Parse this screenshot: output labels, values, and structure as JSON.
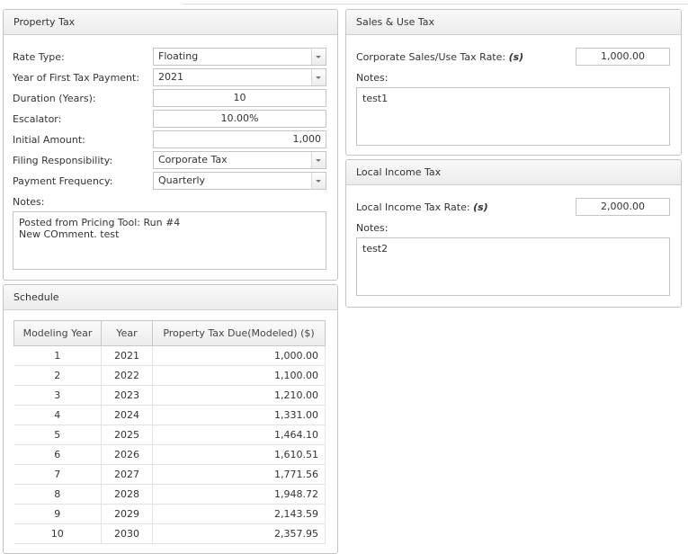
{
  "property_tax": {
    "title": "Property Tax",
    "rate_type": {
      "label": "Rate Type:",
      "value": "Floating"
    },
    "first_payment_year": {
      "label": "Year of First Tax Payment:",
      "value": "2021"
    },
    "duration": {
      "label": "Duration (Years):",
      "value": "10"
    },
    "escalator": {
      "label": "Escalator:",
      "value": "10.00%"
    },
    "initial_amount": {
      "label": "Initial Amount:",
      "value": "1,000"
    },
    "filing_responsibility": {
      "label": "Filing Responsibility:",
      "value": "Corporate Tax"
    },
    "payment_frequency": {
      "label": "Payment Frequency:",
      "value": "Quarterly"
    },
    "notes_label": "Notes:",
    "notes_lines": [
      "Posted from Pricing Tool: Run #4",
      "New COmment. test"
    ]
  },
  "sales_use_tax": {
    "title": "Sales & Use Tax",
    "rate_label": "Corporate Sales/Use Tax Rate:",
    "rate_unit": "(s)",
    "rate_value": "1,000.00",
    "notes_label": "Notes:",
    "notes": "test1"
  },
  "local_income_tax": {
    "title": "Local Income Tax",
    "rate_label": "Local Income Tax Rate:",
    "rate_unit": "(s)",
    "rate_value": "2,000.00",
    "notes_label": "Notes:",
    "notes": "test2"
  },
  "schedule": {
    "title": "Schedule",
    "columns": [
      "Modeling Year",
      "Year",
      "Property Tax Due(Modeled) ($)"
    ],
    "rows": [
      [
        "1",
        "2021",
        "1,000.00"
      ],
      [
        "2",
        "2022",
        "1,100.00"
      ],
      [
        "3",
        "2023",
        "1,210.00"
      ],
      [
        "4",
        "2024",
        "1,331.00"
      ],
      [
        "5",
        "2025",
        "1,464.10"
      ],
      [
        "6",
        "2026",
        "1,610.51"
      ],
      [
        "7",
        "2027",
        "1,771.56"
      ],
      [
        "8",
        "2028",
        "1,948.72"
      ],
      [
        "9",
        "2029",
        "2,143.59"
      ],
      [
        "10",
        "2030",
        "2,357.95"
      ]
    ]
  }
}
